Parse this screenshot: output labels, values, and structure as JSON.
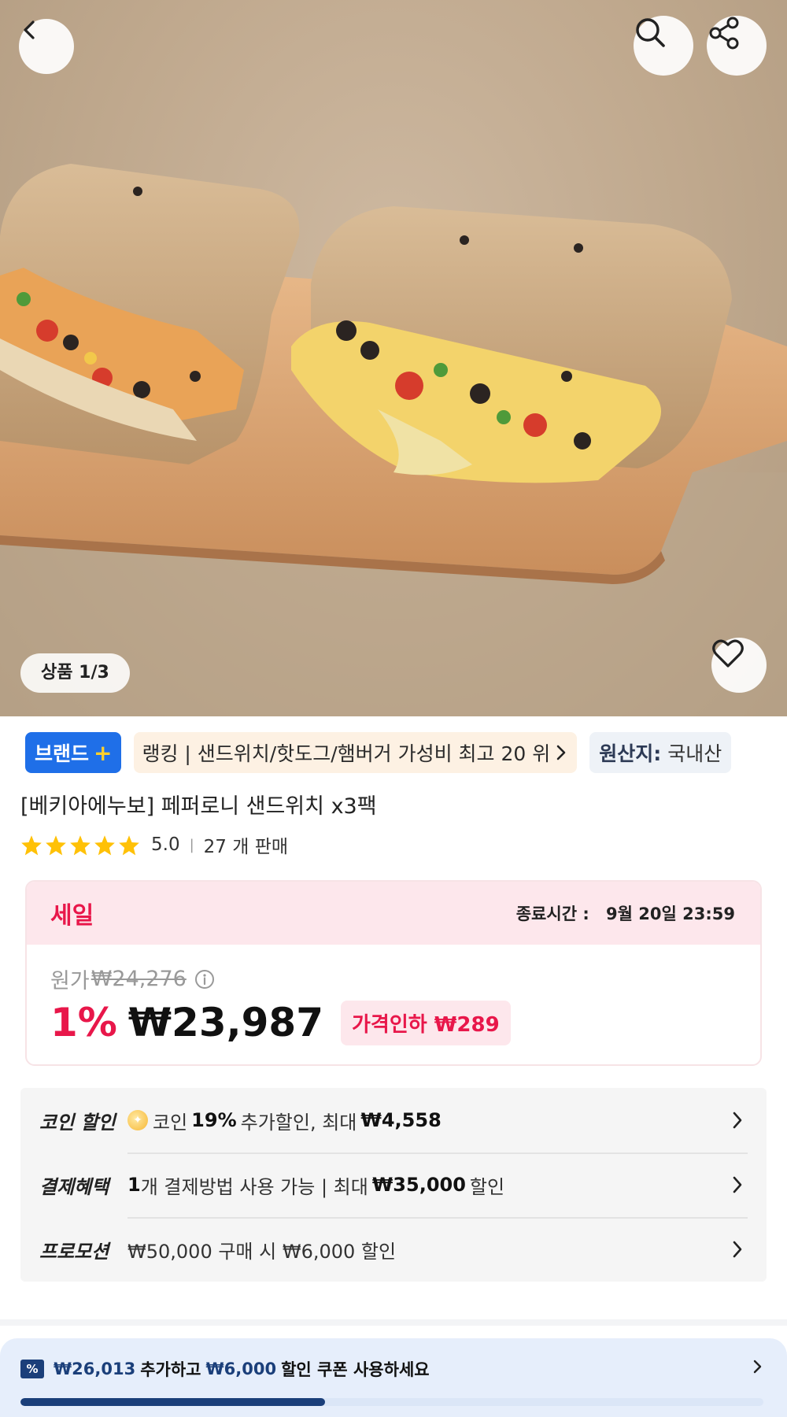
{
  "hero": {
    "image_alt": "pepperoni ciabatta sandwich on wooden board",
    "counter": "상품 1/3"
  },
  "badges": {
    "brand": "브랜드",
    "brand_plus": "+",
    "ranking": "랭킹 | 샌드위치/핫도그/햄버거 가성비 최고 20 위",
    "origin_label": "원산지:",
    "origin_value": "국내산"
  },
  "product": {
    "title": "[베키아에누보] 페퍼로니 샌드위치 x3팩",
    "rating": "5.0",
    "rating_stars": 5,
    "sold": "27 개 판매"
  },
  "sale": {
    "label": "세일",
    "end_label": "종료시간 :",
    "end_time": "9월 20일 23:59",
    "original_label": "원가",
    "original_price": "₩24,276",
    "discount_pct": "1%",
    "price": "₩23,987",
    "price_drop": "가격인하 ₩289"
  },
  "benefits": [
    {
      "label": "코인 할인",
      "pre": "코인",
      "bold1": "19%",
      "mid": "추가할인, 최대",
      "bold2": "₩4,558",
      "post": ""
    },
    {
      "label": "결제혜택",
      "pre": "",
      "bold1": "1",
      "mid": "개 결제방법 사용 가능 | 최대",
      "bold2": "₩35,000",
      "post": "할인"
    },
    {
      "label": "프로모션",
      "pre": "",
      "bold1": "",
      "mid": "₩50,000 구매 시 ₩6,000 할인",
      "bold2": "",
      "post": ""
    }
  ],
  "coupon": {
    "icon": "%",
    "amount1": "₩26,013",
    "text1": "추가하고",
    "amount2": "₩6,000",
    "text2": "할인 쿠폰 사용하세요",
    "progress": 0.41
  },
  "colors": {
    "accent_red": "#e8174a",
    "brand_blue": "#1f6fe8",
    "navy": "#1b3f7a",
    "star": "#ffc107"
  }
}
